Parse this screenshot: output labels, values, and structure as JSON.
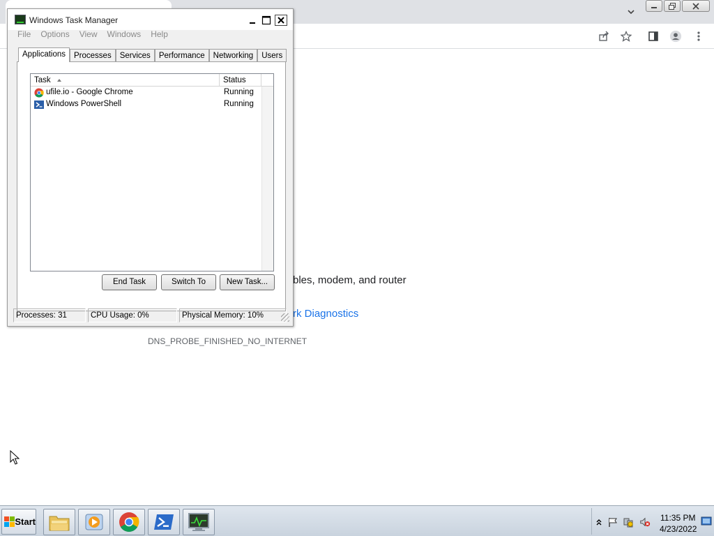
{
  "browser": {
    "error_line1": "bles, modem, and router",
    "error_link": "rk Diagnostics",
    "error_code": "DNS_PROBE_FINISHED_NO_INTERNET",
    "window_buttons": {
      "minimize": "minimize-icon",
      "restore": "restore-icon",
      "close": "close-icon"
    },
    "toolbar_icons": [
      "share-icon",
      "star-icon",
      "side-panel-icon",
      "profile-icon",
      "kebab-menu-icon"
    ]
  },
  "task_manager": {
    "title": "Windows Task Manager",
    "menu": [
      "File",
      "Options",
      "View",
      "Windows",
      "Help"
    ],
    "tabs": [
      "Applications",
      "Processes",
      "Services",
      "Performance",
      "Networking",
      "Users"
    ],
    "active_tab": "Applications",
    "columns": {
      "task": "Task",
      "status": "Status"
    },
    "rows": [
      {
        "task": "ufile.io - Google Chrome",
        "status": "Running",
        "icon": "chrome-icon"
      },
      {
        "task": "Windows PowerShell",
        "status": "Running",
        "icon": "powershell-icon"
      }
    ],
    "buttons": {
      "end_task": "End Task",
      "switch_to": "Switch To",
      "new_task": "New Task..."
    },
    "status_bar": {
      "processes": "Processes: 31",
      "cpu": "CPU Usage: 0%",
      "memory": "Physical Memory: 10%"
    }
  },
  "taskbar": {
    "start_label": "Start",
    "apps": [
      "file-explorer-icon",
      "media-player-icon",
      "chrome-icon",
      "powershell-icon",
      "task-manager-icon"
    ],
    "tray_icons": [
      "show-hidden-icons-icon",
      "action-center-flag-icon",
      "network-icon",
      "volume-muted-icon",
      "show-desktop-icon"
    ],
    "clock": {
      "time": "11:35 PM",
      "date": "4/23/2022"
    }
  }
}
